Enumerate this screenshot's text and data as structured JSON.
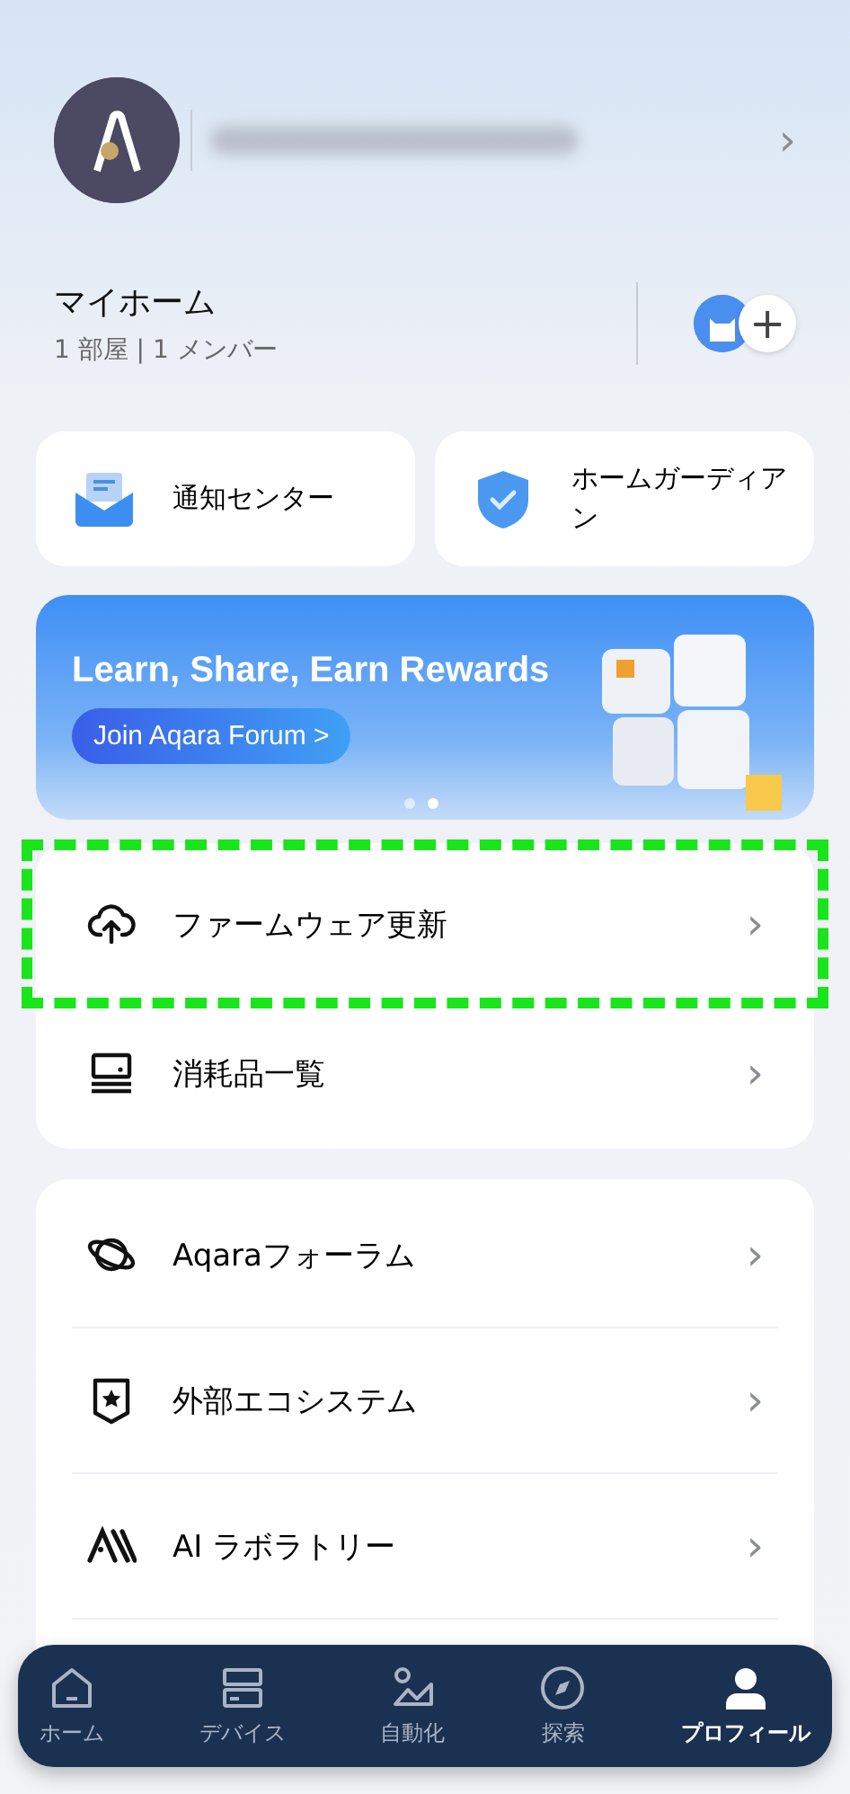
{
  "account": {
    "chevron": "›"
  },
  "home": {
    "name": "マイホーム",
    "summary": "1 部屋 | 1 メンバー",
    "add": "+"
  },
  "shortcuts": [
    {
      "kind": "mail",
      "label": "通知センター"
    },
    {
      "kind": "shield",
      "label": "ホームガーディアン"
    }
  ],
  "banner": {
    "title": "Learn, Share, Earn Rewards",
    "button": "Join Aqara Forum >",
    "dots": [
      {
        "selected": false
      },
      {
        "selected": true
      }
    ]
  },
  "device_menu": [
    {
      "kind": "cloud",
      "label": "ファームウェア更新",
      "highlighted": true
    },
    {
      "kind": "tray",
      "label": "消耗品一覧",
      "highlighted": false
    }
  ],
  "more_menu": [
    {
      "kind": "planet",
      "label": "Aqaraフォーラム"
    },
    {
      "kind": "badge",
      "label": "外部エコシステム"
    },
    {
      "kind": "ai",
      "label": "AI ラボラトリー"
    }
  ],
  "tab_bar": [
    {
      "kind": "home",
      "label": "ホーム",
      "selected": false
    },
    {
      "kind": "devices",
      "label": "デバイス",
      "selected": false
    },
    {
      "kind": "automation",
      "label": "自動化",
      "selected": false
    },
    {
      "kind": "explore",
      "label": "探索",
      "selected": false
    },
    {
      "kind": "profile",
      "label": "プロフィール",
      "selected": true
    }
  ]
}
